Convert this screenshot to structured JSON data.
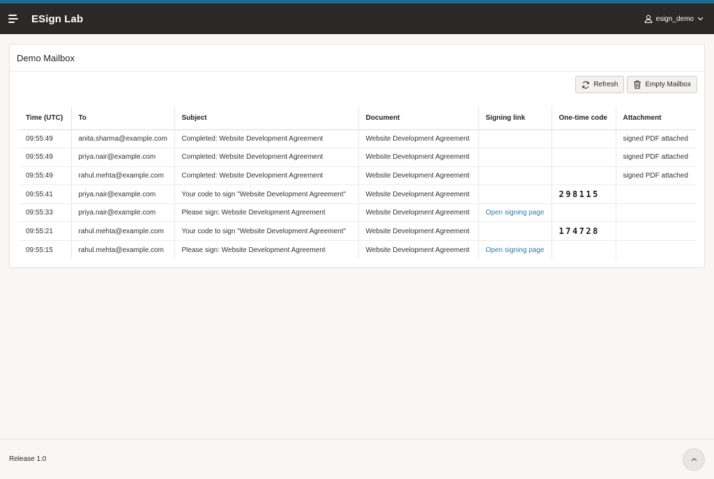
{
  "header": {
    "app_title": "ESign Lab",
    "username": "esign_demo",
    "menu_icon": "hamburger-menu-icon",
    "user_icon": "user-icon",
    "dropdown_icon": "chevron-down-icon"
  },
  "region": {
    "title": "Demo Mailbox",
    "buttons": {
      "refresh_label": "Refresh",
      "refresh_icon": "refresh-icon",
      "empty_label": "Empty Mailbox",
      "empty_icon": "trash-icon"
    }
  },
  "table": {
    "columns": [
      "Time (UTC)",
      "To",
      "Subject",
      "Document",
      "Signing link",
      "One-time code",
      "Attachment"
    ],
    "rows": [
      {
        "time": "09:55:49",
        "to": "anita.sharma@example.com",
        "subject": "Completed: Website Development Agreement",
        "document": "Website Development Agreement",
        "link": "",
        "code": "",
        "attachment": "signed PDF attached"
      },
      {
        "time": "09:55:49",
        "to": "priya.nair@example.com",
        "subject": "Completed: Website Development Agreement",
        "document": "Website Development Agreement",
        "link": "",
        "code": "",
        "attachment": "signed PDF attached"
      },
      {
        "time": "09:55:49",
        "to": "rahul.mehta@example.com",
        "subject": "Completed: Website Development Agreement",
        "document": "Website Development Agreement",
        "link": "",
        "code": "",
        "attachment": "signed PDF attached"
      },
      {
        "time": "09:55:41",
        "to": "priya.nair@example.com",
        "subject": "Your code to sign \"Website Development Agreement\"",
        "document": "Website Development Agreement",
        "link": "",
        "code": "298115",
        "attachment": ""
      },
      {
        "time": "09:55:33",
        "to": "priya.nair@example.com",
        "subject": "Please sign: Website Development Agreement",
        "document": "Website Development Agreement",
        "link": "Open signing page",
        "code": "",
        "attachment": ""
      },
      {
        "time": "09:55:21",
        "to": "rahul.mehta@example.com",
        "subject": "Your code to sign \"Website Development Agreement\"",
        "document": "Website Development Agreement",
        "link": "",
        "code": "174728",
        "attachment": ""
      },
      {
        "time": "09:55:15",
        "to": "rahul.mehta@example.com",
        "subject": "Please sign: Website Development Agreement",
        "document": "Website Development Agreement",
        "link": "Open signing page",
        "code": "",
        "attachment": ""
      }
    ]
  },
  "footer": {
    "release": "Release 1.0",
    "scroll_top_icon": "chevron-up-icon"
  },
  "colors": {
    "accent": "#1c6b92",
    "header_bg": "#2b2927",
    "link": "#1f7bb3"
  }
}
